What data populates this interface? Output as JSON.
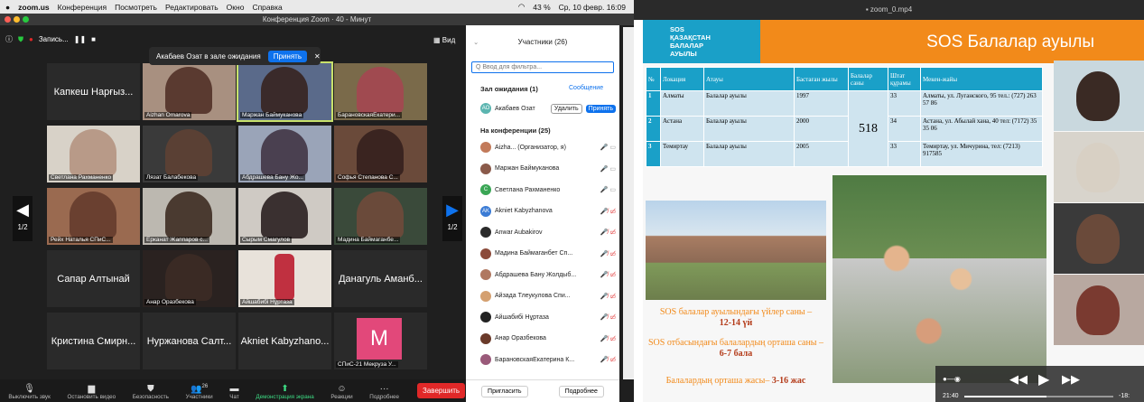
{
  "menubar": {
    "items": [
      "zoom.us",
      "Конференция",
      "Посмотреть",
      "Редактировать",
      "Окно",
      "Справка"
    ],
    "status": "43 %",
    "date": "Ср, 10 февр. 16:09"
  },
  "window": {
    "title": "Конференция Zoom · 40 - Минут"
  },
  "recording": {
    "label": "Запись...",
    "view": "Вид"
  },
  "waiting_banner": {
    "text": "Акабаев Озат в зале ожидания",
    "accept": "Принять"
  },
  "tiles": [
    {
      "name": "Капкеш Нарғыз...",
      "cap": ""
    },
    {
      "name": "",
      "cap": "Aizhan Omarova"
    },
    {
      "name": "",
      "cap": "Маржан Баймуканова"
    },
    {
      "name": "",
      "cap": "БарановскаяЕкатери..."
    },
    {
      "name": "",
      "cap": "Светлана Рахманенко"
    },
    {
      "name": "",
      "cap": "Лязат Балабекова"
    },
    {
      "name": "",
      "cap": "Абдрашева Бану Жо..."
    },
    {
      "name": "",
      "cap": "Софья Степанова С..."
    },
    {
      "name": "",
      "cap": "Рейх Наталья СПиС..."
    },
    {
      "name": "",
      "cap": "Ерканат Жаппаров с..."
    },
    {
      "name": "",
      "cap": "Сырым Смагулов"
    },
    {
      "name": "",
      "cap": "Мадина Баймаганбе..."
    },
    {
      "name": "Сапар Алтынай",
      "cap": ""
    },
    {
      "name": "",
      "cap": "Анар Оразбекова"
    },
    {
      "name": "",
      "cap": "Айшабибі Нұртаза"
    },
    {
      "name": "Данагуль Аманб...",
      "cap": ""
    },
    {
      "name": "Кристина Смирн...",
      "cap": ""
    },
    {
      "name": "Нуржанова Салт...",
      "cap": ""
    },
    {
      "name": "Akniet Kabyzhano...",
      "cap": ""
    },
    {
      "name": "M",
      "cap": "СПиС-21 Мекруза У..."
    }
  ],
  "page_indicator": "1/2",
  "toolbar": [
    "Выключить звук",
    "Остановить видео",
    "Безопасность",
    "Участники",
    "Чат",
    "Демонстрация экрана",
    "Реакции",
    "Подробнее"
  ],
  "participants_count": "26",
  "end": "Завершить",
  "panel": {
    "title": "Участники (26)",
    "search": "Q Ввод для фильтра...",
    "waiting": "Зал ожидания (1)",
    "message": "Сообщение",
    "waiting_user": "Акабаев Озат",
    "remove": "Удалить",
    "accept": "Принять",
    "in_meeting": "На конференции (25)",
    "invite": "Пригласить",
    "more": "Подробнее"
  },
  "participants": [
    {
      "n": "Aizha... (Организатор, я)",
      "ini": "",
      "c": "#c27a5a",
      "red": false
    },
    {
      "n": "Маржан Баймуканова",
      "ini": "",
      "c": "#8a5a4a",
      "red": false
    },
    {
      "n": "Светлана Рахманенко",
      "ini": "С",
      "c": "#3aa655",
      "red": false
    },
    {
      "n": "Akniet Kabyzhanova",
      "ini": "AK",
      "c": "#3a7bd5",
      "red": true
    },
    {
      "n": "Anwar Aubakirov",
      "ini": "",
      "c": "#2a2a2a",
      "red": true
    },
    {
      "n": "Мадина Баймаганбет Сп...",
      "ini": "",
      "c": "#8b4a3a",
      "red": true
    },
    {
      "n": "Абдрашева Бану Жолдыб...",
      "ini": "",
      "c": "#b07860",
      "red": true
    },
    {
      "n": "Айзада Тлеукулова Спи...",
      "ini": "",
      "c": "#d4a070",
      "red": true
    },
    {
      "n": "Айшабибі Нұртаза",
      "ini": "",
      "c": "#222",
      "red": true
    },
    {
      "n": "Анар Оразбекова",
      "ini": "",
      "c": "#6a3a2a",
      "red": true
    },
    {
      "n": "БарановскаяЕкатерина К...",
      "ini": "",
      "c": "#9a5a7a",
      "red": true
    }
  ],
  "video": {
    "title": "zoom_0.mp4",
    "time_elapsed": "21:40",
    "time_left": "-18:"
  },
  "slide": {
    "logo": "SOS\nҚАЗАҚСТАН\nБАЛАЛАР\nАУЫЛЫ",
    "title": "SOS Балалар ауылы",
    "headers": [
      "№",
      "Локация",
      "Атауы",
      "Бастаған жылы",
      "Балалар саны",
      "Штат құрамы",
      "Мекен-жайы"
    ],
    "rows": [
      [
        "1",
        "Алматы",
        "Балалар ауылы",
        "1997",
        "33",
        "Алматы, ул. Луганского, 95 тел.: (727) 263 57 86"
      ],
      [
        "2",
        "Астана",
        "Балалар ауылы",
        "2000",
        "34",
        "Астана, ул. Абылай хана, 40 тел: (7172) 35 35 06"
      ],
      [
        "3",
        "Темиртау",
        "Балалар ауылы",
        "2005",
        "33",
        "Темиртау, ул. Мичурина, тел: (7213) 917585"
      ]
    ],
    "children_total": "518",
    "line1": "SOS балалар ауылындағы үйлер саны –",
    "line1b": "12-14 үй",
    "line2": "SOS отбасындағы балалардың орташа саны –",
    "line2b": "6-7 бала",
    "line3": "Балалардың орташа жасы–",
    "line3b": "3-16 жас"
  }
}
